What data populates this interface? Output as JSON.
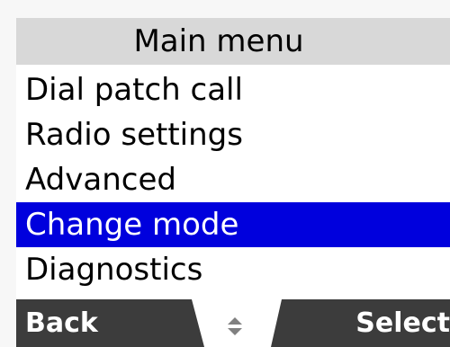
{
  "header": {
    "title": "Main menu"
  },
  "menu": {
    "items": [
      {
        "label": "Dial patch call",
        "selected": false
      },
      {
        "label": "Radio settings",
        "selected": false
      },
      {
        "label": "Advanced",
        "selected": false
      },
      {
        "label": "Change mode",
        "selected": true
      },
      {
        "label": "Diagnostics",
        "selected": false
      }
    ]
  },
  "softkeys": {
    "left_label": "Back",
    "right_label": "Select",
    "center_icon": "up-down-scroll-icon"
  },
  "colors": {
    "titlebar_bg": "#d8d8d8",
    "selection_bg": "#0000dd",
    "softkey_bg": "#3c3c3c",
    "menu_bg": "#ffffff"
  }
}
